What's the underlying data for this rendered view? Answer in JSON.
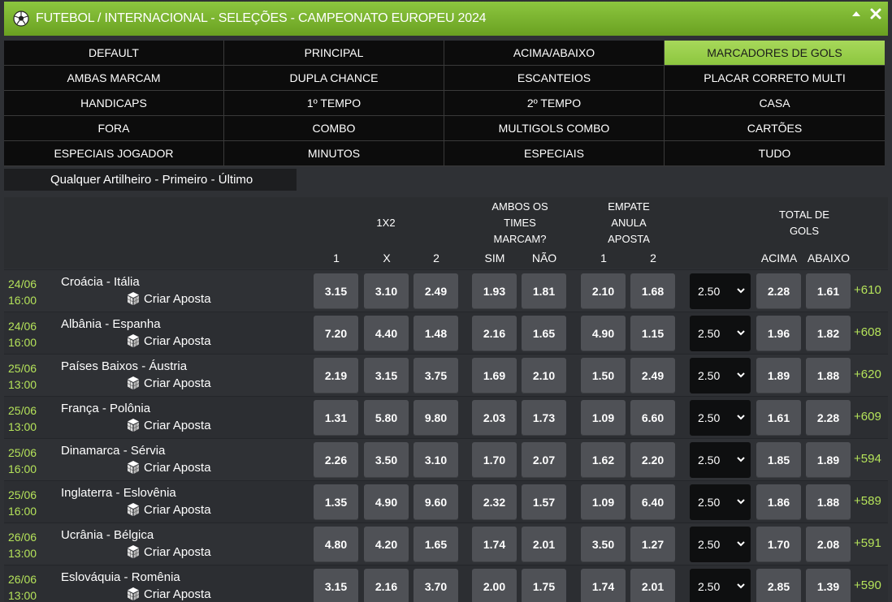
{
  "header": {
    "title": "FUTEBOL / INTERNACIONAL - SELEÇÕES - CAMPEONATO EUROPEU 2024",
    "icons": [
      "soccer-ball-icon",
      "chevron-up-icon",
      "close-icon"
    ]
  },
  "tabs": [
    {
      "label": "DEFAULT"
    },
    {
      "label": "PRINCIPAL"
    },
    {
      "label": "ACIMA/ABAIXO"
    },
    {
      "label": "MARCADORES DE GOLS",
      "active": true
    },
    {
      "label": "AMBAS MARCAM"
    },
    {
      "label": "DUPLA CHANCE"
    },
    {
      "label": "ESCANTEIOS"
    },
    {
      "label": "PLACAR CORRETO MULTI"
    },
    {
      "label": "HANDICAPS"
    },
    {
      "label": "1º TEMPO"
    },
    {
      "label": "2º TEMPO"
    },
    {
      "label": "CASA"
    },
    {
      "label": "FORA"
    },
    {
      "label": "COMBO"
    },
    {
      "label": "MULTIGOLS COMBO"
    },
    {
      "label": "CARTÕES"
    },
    {
      "label": "ESPECIAIS JOGADOR"
    },
    {
      "label": "MINUTOS"
    },
    {
      "label": "ESPECIAIS"
    },
    {
      "label": "TUDO"
    }
  ],
  "subfilter": "Qualquer Artilheiro - Primeiro - Último",
  "columns": {
    "g1x2": "1X2",
    "ambos": "AMBOS OS TIMES MARCAM?",
    "ambos_lines": [
      "AMBOS OS",
      "TIMES",
      "MARCAM?"
    ],
    "empate": "EMPATE ANULA APOSTA",
    "empate_lines": [
      "EMPATE",
      "ANULA",
      "APOSTA"
    ],
    "total": "TOTAL DE GOLS",
    "total_lines": [
      "TOTAL DE",
      "GOLS"
    ],
    "sub": [
      "1",
      "X",
      "2",
      "SIM",
      "NÃO",
      "1",
      "2",
      "ACIMA",
      "ABAIXO"
    ]
  },
  "criar_label": "Criar Aposta",
  "accent_color": "#b5e35a",
  "rows": [
    {
      "date": "24/06",
      "time": "16:00",
      "match": "Croácia - Itália",
      "odds": [
        "3.15",
        "3.10",
        "2.49",
        "1.93",
        "1.81",
        "2.10",
        "1.68"
      ],
      "line": "2.50",
      "over": "2.28",
      "under": "1.61",
      "more": "+610"
    },
    {
      "date": "24/06",
      "time": "16:00",
      "match": "Albânia - Espanha",
      "odds": [
        "7.20",
        "4.40",
        "1.48",
        "2.16",
        "1.65",
        "4.90",
        "1.15"
      ],
      "line": "2.50",
      "over": "1.96",
      "under": "1.82",
      "more": "+608"
    },
    {
      "date": "25/06",
      "time": "13:00",
      "match": "Países Baixos - Áustria",
      "odds": [
        "2.19",
        "3.15",
        "3.75",
        "1.69",
        "2.10",
        "1.50",
        "2.49"
      ],
      "line": "2.50",
      "over": "1.89",
      "under": "1.88",
      "more": "+620"
    },
    {
      "date": "25/06",
      "time": "13:00",
      "match": "França - Polônia",
      "odds": [
        "1.31",
        "5.80",
        "9.80",
        "2.03",
        "1.73",
        "1.09",
        "6.60"
      ],
      "line": "2.50",
      "over": "1.61",
      "under": "2.28",
      "more": "+609"
    },
    {
      "date": "25/06",
      "time": "16:00",
      "match": "Dinamarca - Sérvia",
      "odds": [
        "2.26",
        "3.50",
        "3.10",
        "1.70",
        "2.07",
        "1.62",
        "2.20"
      ],
      "line": "2.50",
      "over": "1.85",
      "under": "1.89",
      "more": "+594"
    },
    {
      "date": "25/06",
      "time": "16:00",
      "match": "Inglaterra - Eslovênia",
      "odds": [
        "1.35",
        "4.90",
        "9.60",
        "2.32",
        "1.57",
        "1.09",
        "6.40"
      ],
      "line": "2.50",
      "over": "1.86",
      "under": "1.88",
      "more": "+589"
    },
    {
      "date": "26/06",
      "time": "13:00",
      "match": "Ucrânia - Bélgica",
      "odds": [
        "4.80",
        "4.20",
        "1.65",
        "1.74",
        "2.01",
        "3.50",
        "1.27"
      ],
      "line": "2.50",
      "over": "1.70",
      "under": "2.08",
      "more": "+591"
    },
    {
      "date": "26/06",
      "time": "13:00",
      "match": "Eslováquia - Romênia",
      "odds": [
        "3.15",
        "2.16",
        "3.70",
        "2.00",
        "1.75",
        "1.74",
        "2.01"
      ],
      "line": "2.50",
      "over": "2.85",
      "under": "1.39",
      "more": "+590"
    }
  ]
}
